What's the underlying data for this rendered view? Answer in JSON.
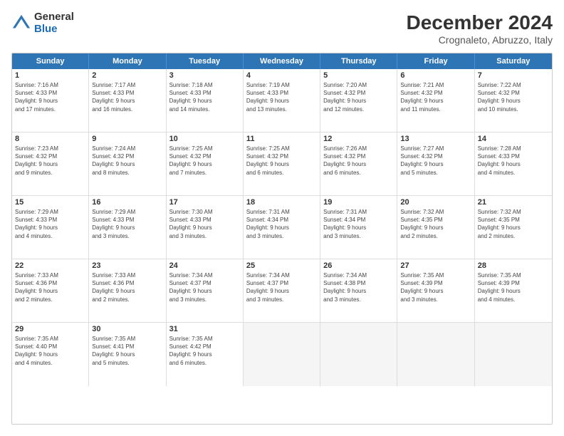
{
  "logo": {
    "general": "General",
    "blue": "Blue"
  },
  "header": {
    "month": "December 2024",
    "location": "Crognaleto, Abruzzo, Italy"
  },
  "weekdays": [
    "Sunday",
    "Monday",
    "Tuesday",
    "Wednesday",
    "Thursday",
    "Friday",
    "Saturday"
  ],
  "weeks": [
    [
      {
        "day": "1",
        "info": "Sunrise: 7:16 AM\nSunset: 4:33 PM\nDaylight: 9 hours\nand 17 minutes."
      },
      {
        "day": "2",
        "info": "Sunrise: 7:17 AM\nSunset: 4:33 PM\nDaylight: 9 hours\nand 16 minutes."
      },
      {
        "day": "3",
        "info": "Sunrise: 7:18 AM\nSunset: 4:33 PM\nDaylight: 9 hours\nand 14 minutes."
      },
      {
        "day": "4",
        "info": "Sunrise: 7:19 AM\nSunset: 4:33 PM\nDaylight: 9 hours\nand 13 minutes."
      },
      {
        "day": "5",
        "info": "Sunrise: 7:20 AM\nSunset: 4:32 PM\nDaylight: 9 hours\nand 12 minutes."
      },
      {
        "day": "6",
        "info": "Sunrise: 7:21 AM\nSunset: 4:32 PM\nDaylight: 9 hours\nand 11 minutes."
      },
      {
        "day": "7",
        "info": "Sunrise: 7:22 AM\nSunset: 4:32 PM\nDaylight: 9 hours\nand 10 minutes."
      }
    ],
    [
      {
        "day": "8",
        "info": "Sunrise: 7:23 AM\nSunset: 4:32 PM\nDaylight: 9 hours\nand 9 minutes."
      },
      {
        "day": "9",
        "info": "Sunrise: 7:24 AM\nSunset: 4:32 PM\nDaylight: 9 hours\nand 8 minutes."
      },
      {
        "day": "10",
        "info": "Sunrise: 7:25 AM\nSunset: 4:32 PM\nDaylight: 9 hours\nand 7 minutes."
      },
      {
        "day": "11",
        "info": "Sunrise: 7:25 AM\nSunset: 4:32 PM\nDaylight: 9 hours\nand 6 minutes."
      },
      {
        "day": "12",
        "info": "Sunrise: 7:26 AM\nSunset: 4:32 PM\nDaylight: 9 hours\nand 6 minutes."
      },
      {
        "day": "13",
        "info": "Sunrise: 7:27 AM\nSunset: 4:32 PM\nDaylight: 9 hours\nand 5 minutes."
      },
      {
        "day": "14",
        "info": "Sunrise: 7:28 AM\nSunset: 4:33 PM\nDaylight: 9 hours\nand 4 minutes."
      }
    ],
    [
      {
        "day": "15",
        "info": "Sunrise: 7:29 AM\nSunset: 4:33 PM\nDaylight: 9 hours\nand 4 minutes."
      },
      {
        "day": "16",
        "info": "Sunrise: 7:29 AM\nSunset: 4:33 PM\nDaylight: 9 hours\nand 3 minutes."
      },
      {
        "day": "17",
        "info": "Sunrise: 7:30 AM\nSunset: 4:33 PM\nDaylight: 9 hours\nand 3 minutes."
      },
      {
        "day": "18",
        "info": "Sunrise: 7:31 AM\nSunset: 4:34 PM\nDaylight: 9 hours\nand 3 minutes."
      },
      {
        "day": "19",
        "info": "Sunrise: 7:31 AM\nSunset: 4:34 PM\nDaylight: 9 hours\nand 3 minutes."
      },
      {
        "day": "20",
        "info": "Sunrise: 7:32 AM\nSunset: 4:35 PM\nDaylight: 9 hours\nand 2 minutes."
      },
      {
        "day": "21",
        "info": "Sunrise: 7:32 AM\nSunset: 4:35 PM\nDaylight: 9 hours\nand 2 minutes."
      }
    ],
    [
      {
        "day": "22",
        "info": "Sunrise: 7:33 AM\nSunset: 4:36 PM\nDaylight: 9 hours\nand 2 minutes."
      },
      {
        "day": "23",
        "info": "Sunrise: 7:33 AM\nSunset: 4:36 PM\nDaylight: 9 hours\nand 2 minutes."
      },
      {
        "day": "24",
        "info": "Sunrise: 7:34 AM\nSunset: 4:37 PM\nDaylight: 9 hours\nand 3 minutes."
      },
      {
        "day": "25",
        "info": "Sunrise: 7:34 AM\nSunset: 4:37 PM\nDaylight: 9 hours\nand 3 minutes."
      },
      {
        "day": "26",
        "info": "Sunrise: 7:34 AM\nSunset: 4:38 PM\nDaylight: 9 hours\nand 3 minutes."
      },
      {
        "day": "27",
        "info": "Sunrise: 7:35 AM\nSunset: 4:39 PM\nDaylight: 9 hours\nand 3 minutes."
      },
      {
        "day": "28",
        "info": "Sunrise: 7:35 AM\nSunset: 4:39 PM\nDaylight: 9 hours\nand 4 minutes."
      }
    ],
    [
      {
        "day": "29",
        "info": "Sunrise: 7:35 AM\nSunset: 4:40 PM\nDaylight: 9 hours\nand 4 minutes."
      },
      {
        "day": "30",
        "info": "Sunrise: 7:35 AM\nSunset: 4:41 PM\nDaylight: 9 hours\nand 5 minutes."
      },
      {
        "day": "31",
        "info": "Sunrise: 7:35 AM\nSunset: 4:42 PM\nDaylight: 9 hours\nand 6 minutes."
      },
      {
        "day": "",
        "info": ""
      },
      {
        "day": "",
        "info": ""
      },
      {
        "day": "",
        "info": ""
      },
      {
        "day": "",
        "info": ""
      }
    ]
  ]
}
